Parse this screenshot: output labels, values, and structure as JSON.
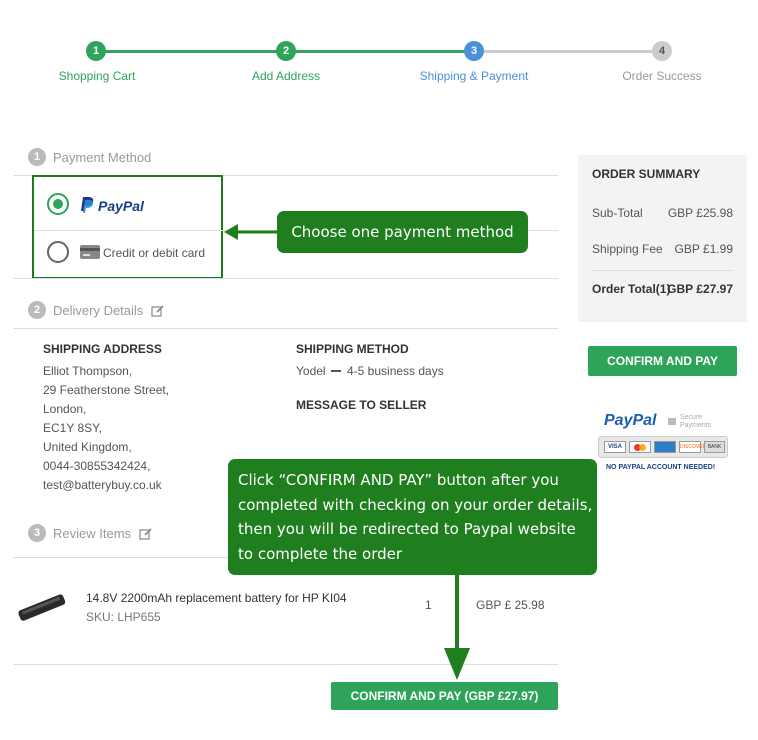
{
  "progress": {
    "steps": [
      {
        "num": "1",
        "label": "Shopping Cart"
      },
      {
        "num": "2",
        "label": "Add Address"
      },
      {
        "num": "3",
        "label": "Shipping & Payment"
      },
      {
        "num": "4",
        "label": "Order Success"
      }
    ],
    "colors": {
      "done": "#2ea45a",
      "current": "#4a8fd8",
      "pending": "#cccccc"
    }
  },
  "payment": {
    "section_num": "1",
    "title": "Payment Method",
    "options": [
      {
        "label": "PayPal",
        "selected": true
      },
      {
        "label": "Credit or debit card",
        "selected": false
      }
    ]
  },
  "callout_payment": "Choose one payment method",
  "delivery": {
    "section_num": "2",
    "title": "Delivery Details",
    "shipping_address_label": "SHIPPING ADDRESS",
    "address_lines": [
      "Elliot Thompson,",
      "29 Featherstone Street,",
      "London,",
      "EC1Y 8SY,",
      "United Kingdom,",
      "0044-30855342424,",
      "test@batterybuy.co.uk"
    ],
    "shipping_method_label": "SHIPPING METHOD",
    "carrier": "Yodel",
    "delivery_time": "4-5 business days",
    "message_label": "MESSAGE TO SELLER"
  },
  "callout_confirm": [
    "Click “CONFIRM AND PAY” button after you",
    "completed with checking on your order details,",
    "then you will be redirected to Paypal website",
    "to complete the order"
  ],
  "review": {
    "section_num": "3",
    "title": "Review Items",
    "item": {
      "name": "14.8V 2200mAh replacement battery for HP KI04",
      "sku": "SKU: LHP655",
      "qty": "1",
      "price": "GBP £ 25.98"
    },
    "confirm_button": "CONFIRM AND PAY (GBP £27.97)"
  },
  "summary": {
    "title": "ORDER SUMMARY",
    "subtotal_label": "Sub-Total",
    "subtotal_value": "GBP £25.98",
    "shipping_label": "Shipping Fee",
    "shipping_value": "GBP £1.99",
    "total_label": "Order Total(1)",
    "total_value": "GBP £27.97",
    "confirm_button": "CONFIRM AND PAY"
  },
  "paypal_badge": {
    "logo": "PayPal",
    "secure": "Secure Payments",
    "cards": [
      "VISA",
      "MasterCard",
      "AMEX",
      "DISCOVER",
      "BANK"
    ],
    "note": "NO PAYPAL ACCOUNT NEEDED!"
  }
}
